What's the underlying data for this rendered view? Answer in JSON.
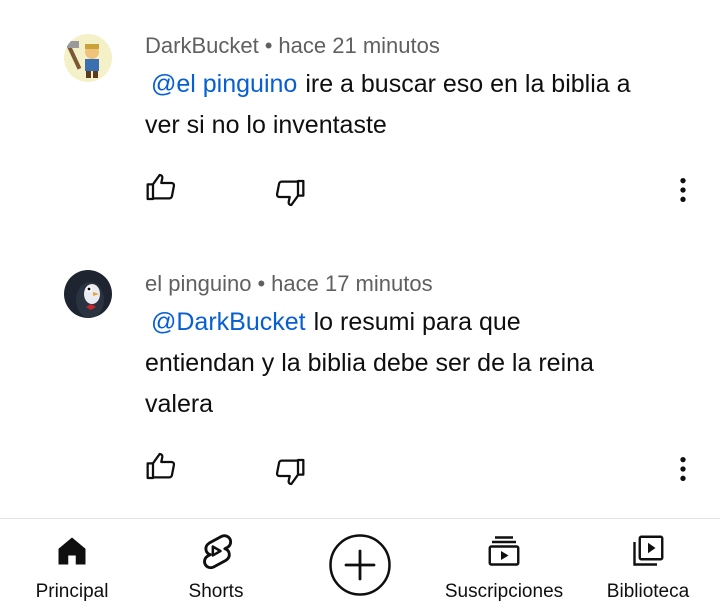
{
  "comments": [
    {
      "author": "DarkBucket",
      "time": "hace 21 minutos",
      "mention": "@el pinguino",
      "text_line1": "ire a buscar eso en la biblia a",
      "text_line2": "ver si no lo inventaste",
      "avatar_icon": "miner-character-icon"
    },
    {
      "author": "el pinguino",
      "time": "hace 17 minutos",
      "mention": "@DarkBucket",
      "text_line1": "lo resumi para que",
      "text_line2": "entiendan y la biblia debe ser de la reina",
      "text_line3": "valera",
      "avatar_icon": "penguin-icon"
    }
  ],
  "separator": "•",
  "nav": {
    "items": [
      {
        "label": "Principal",
        "icon": "home-icon"
      },
      {
        "label": "Shorts",
        "icon": "shorts-icon"
      },
      {
        "label": "",
        "icon": "create-plus-icon"
      },
      {
        "label": "Suscripciones",
        "icon": "subscriptions-icon"
      },
      {
        "label": "Biblioteca",
        "icon": "library-icon"
      }
    ]
  },
  "colors": {
    "mention": "#065fd4",
    "meta": "#606060",
    "text": "#0f0f0f"
  }
}
